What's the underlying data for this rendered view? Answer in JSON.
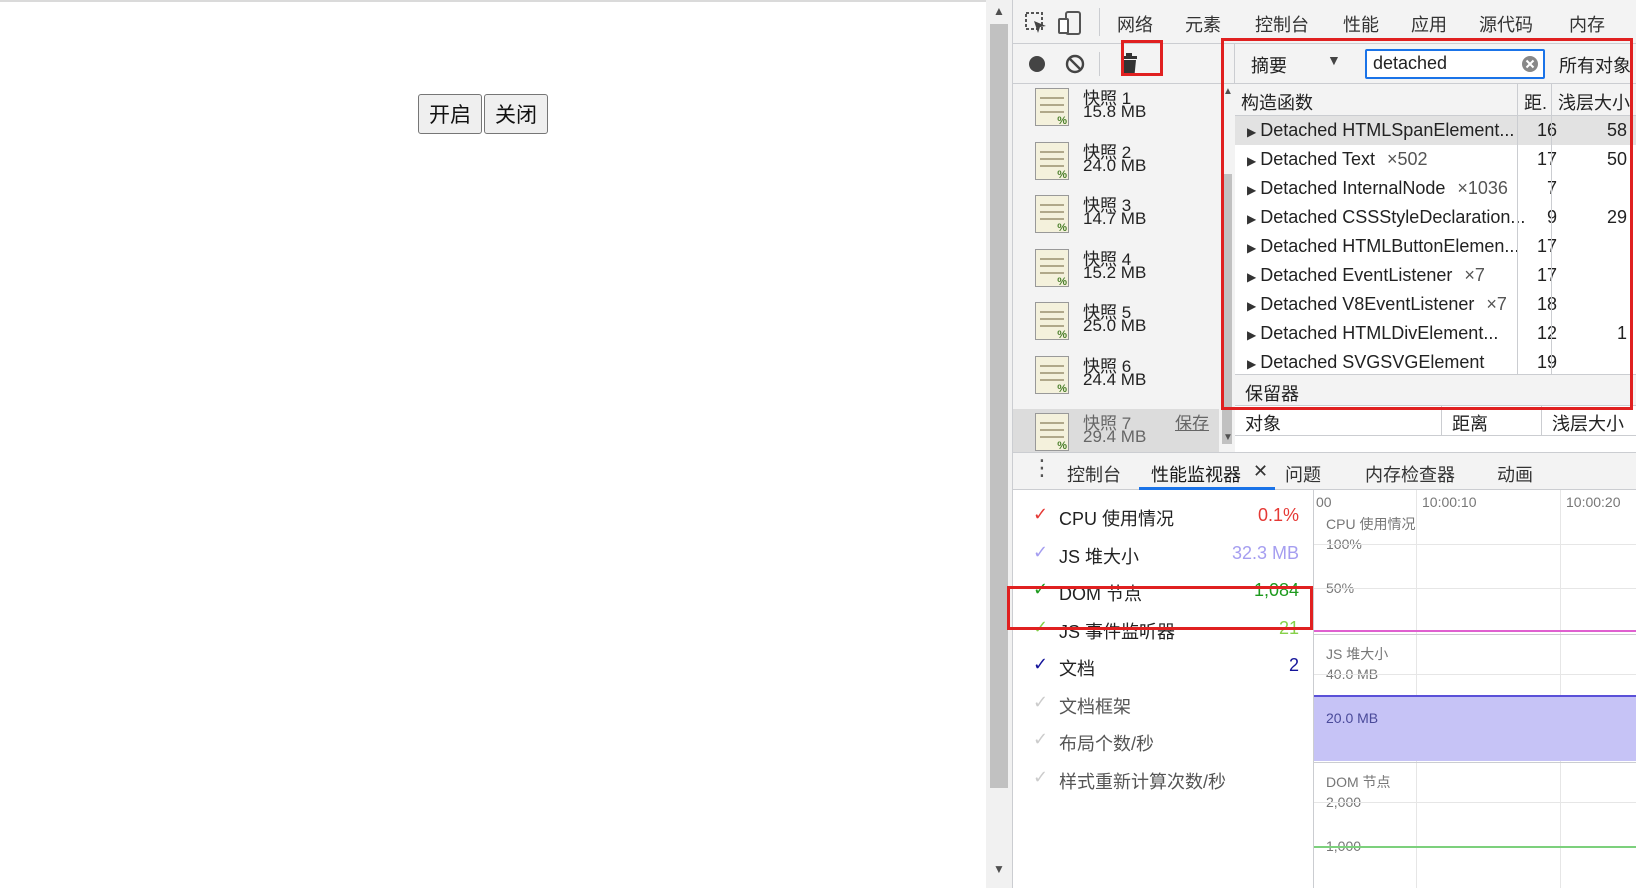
{
  "page": {
    "buttons": [
      "开启",
      "关闭"
    ]
  },
  "devtools": {
    "tabs": [
      "网络",
      "元素",
      "控制台",
      "性能",
      "应用",
      "源代码",
      "内存"
    ],
    "snapshots": [
      {
        "name": "快照 1",
        "size": "15.8 MB"
      },
      {
        "name": "快照 2",
        "size": "24.0 MB"
      },
      {
        "name": "快照 3",
        "size": "14.7 MB"
      },
      {
        "name": "快照 4",
        "size": "15.2 MB"
      },
      {
        "name": "快照 5",
        "size": "25.0 MB"
      },
      {
        "name": "快照 6",
        "size": "24.4 MB"
      },
      {
        "name": "快照 7",
        "size": "29.4 MB",
        "action": "保存"
      }
    ],
    "summary": {
      "view": "摘要",
      "filter": "detached",
      "scope": "所有对象",
      "columns": [
        "构造函数",
        "距.",
        "浅层大小"
      ],
      "rows": [
        {
          "name": "Detached HTMLSpanElement...",
          "count": "",
          "distance": "16",
          "shallow": "58"
        },
        {
          "name": "Detached Text",
          "count": "×502",
          "distance": "17",
          "shallow": "50"
        },
        {
          "name": "Detached InternalNode",
          "count": "×1036",
          "distance": "7",
          "shallow": ""
        },
        {
          "name": "Detached CSSStyleDeclaration...",
          "count": "",
          "distance": "9",
          "shallow": "29"
        },
        {
          "name": "Detached HTMLButtonElemen...",
          "count": "",
          "distance": "17",
          "shallow": ""
        },
        {
          "name": "Detached EventListener",
          "count": "×7",
          "distance": "17",
          "shallow": ""
        },
        {
          "name": "Detached V8EventListener",
          "count": "×7",
          "distance": "18",
          "shallow": ""
        },
        {
          "name": "Detached HTMLDivElement...",
          "count": "",
          "distance": "12",
          "shallow": "1"
        },
        {
          "name": "Detached SVGSVGElement",
          "count": "",
          "distance": "19",
          "shallow": ""
        }
      ],
      "retainers": "保留器",
      "retainer_columns": [
        "对象",
        "距离",
        "浅层大小"
      ]
    },
    "drawer": {
      "tabs": [
        "控制台",
        "性能监视器",
        "问题",
        "内存检查器",
        "动画"
      ],
      "metrics": [
        {
          "label": "CPU 使用情况",
          "value": "0.1%",
          "color": "#e53935",
          "checked": true
        },
        {
          "label": "JS 堆大小",
          "value": "32.3 MB",
          "color": "#a59ef0",
          "checked": true
        },
        {
          "label": "DOM 节点",
          "value": "1,084",
          "color": "#1e9a1e",
          "checked": true
        },
        {
          "label": "JS 事件监听器",
          "value": "21",
          "color": "#86d049",
          "checked": true
        },
        {
          "label": "文档",
          "value": "2",
          "color": "#14149a",
          "checked": true
        },
        {
          "label": "文档框架",
          "value": "",
          "color": "#cccccc",
          "checked": false
        },
        {
          "label": "布局个数/秒",
          "value": "",
          "color": "#cccccc",
          "checked": false
        },
        {
          "label": "样式重新计算次数/秒",
          "value": "",
          "color": "#cccccc",
          "checked": false
        }
      ],
      "graph": {
        "times": [
          "00",
          "10:00:10",
          "10:00:20"
        ],
        "cpu_label": "CPU 使用情况",
        "cpu_ticks": [
          "100%",
          "50%"
        ],
        "js_label": "JS 堆大小",
        "js_ticks": [
          "40.0 MB",
          "20.0 MB"
        ],
        "dom_label": "DOM 节点",
        "dom_ticks": [
          "2,000",
          "1,000"
        ]
      }
    }
  }
}
